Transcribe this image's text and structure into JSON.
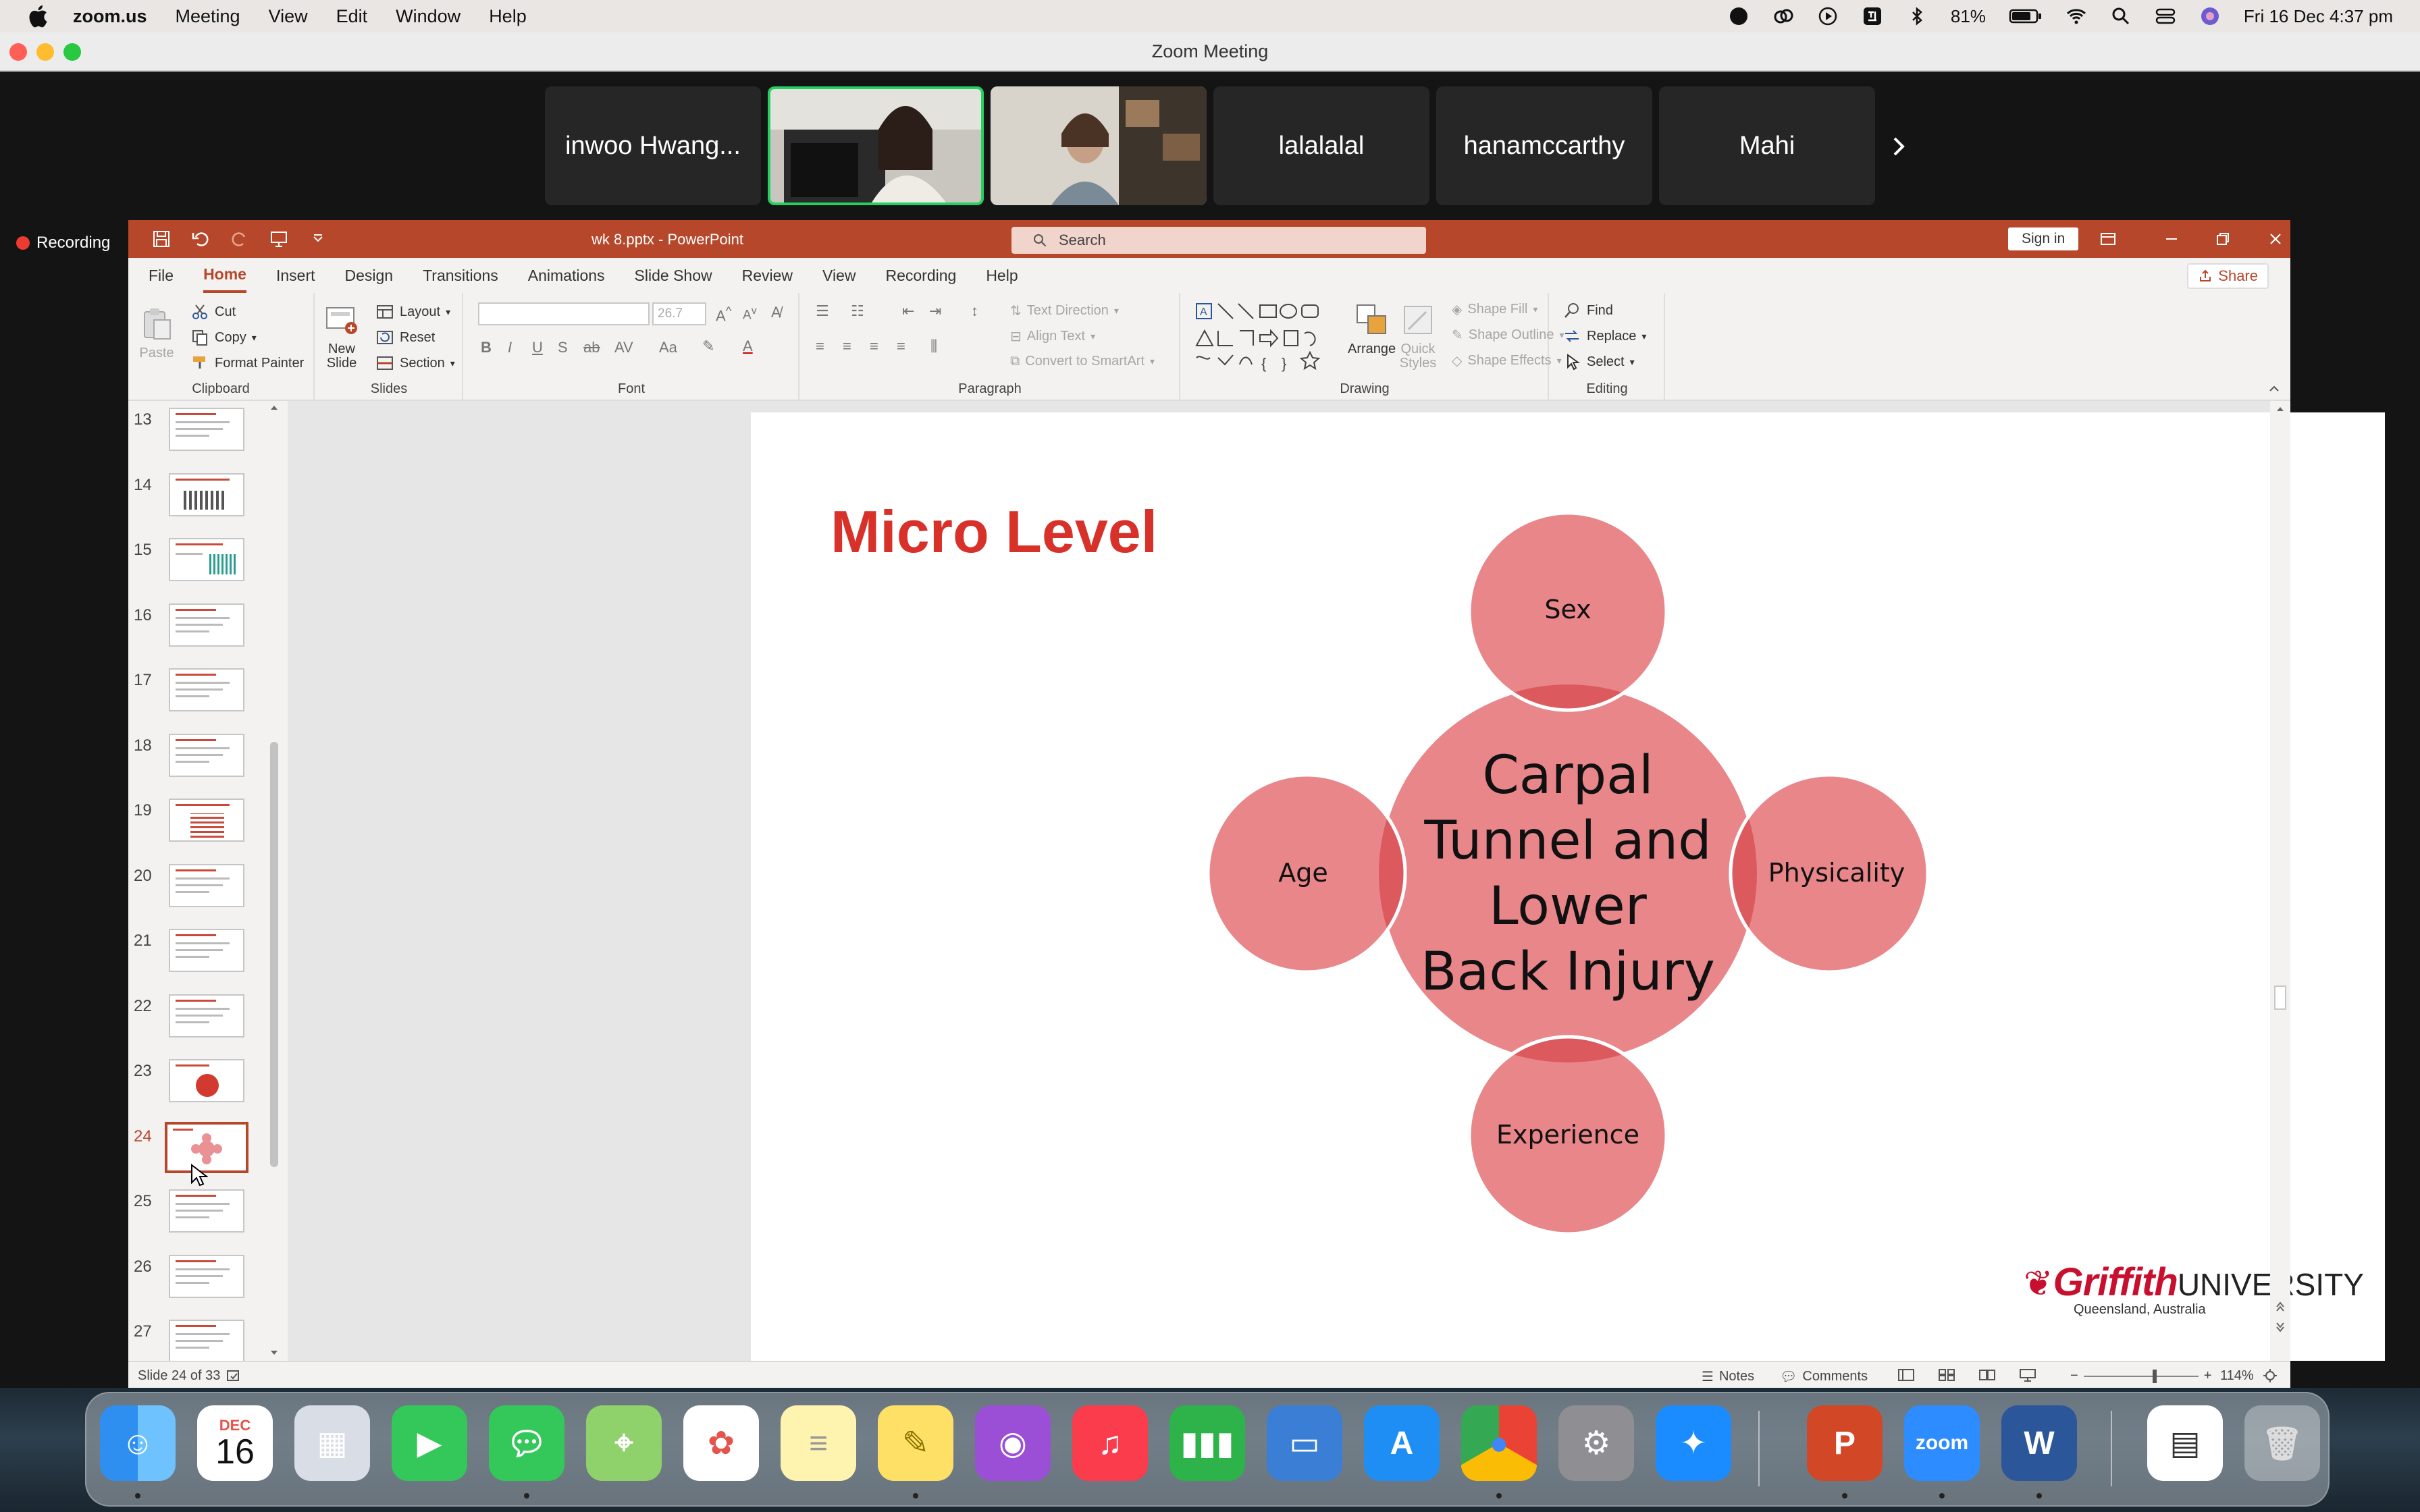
{
  "menubar": {
    "app_name": "zoom.us",
    "items": [
      "Meeting",
      "View",
      "Edit",
      "Window",
      "Help"
    ],
    "battery": "81%",
    "datetime": "Fri 16 Dec  4:37 pm"
  },
  "zoom": {
    "window_title": "Zoom Meeting",
    "recording_label": "Recording",
    "participants": [
      {
        "name": "inwoo Hwang...",
        "video": false
      },
      {
        "name": "",
        "video": true,
        "active": true
      },
      {
        "name": "",
        "video": true
      },
      {
        "name": "lalalalal",
        "video": false
      },
      {
        "name": "hanamccarthy",
        "video": false
      },
      {
        "name": "Mahi",
        "video": false
      }
    ]
  },
  "powerpoint": {
    "doc_title": "wk 8.pptx  -  PowerPoint",
    "search_placeholder": "Search",
    "signin_label": "Sign in",
    "share_label": "Share",
    "tabs": [
      "File",
      "Home",
      "Insert",
      "Design",
      "Transitions",
      "Animations",
      "Slide Show",
      "Review",
      "View",
      "Recording",
      "Help"
    ],
    "selected_tab": "Home",
    "ribbon": {
      "clipboard": {
        "label": "Clipboard",
        "paste": "Paste",
        "cut": "Cut",
        "copy": "Copy",
        "format_painter": "Format Painter"
      },
      "slides": {
        "label": "Slides",
        "new_slide": "New",
        "new_slide2": "Slide",
        "layout": "Layout",
        "reset": "Reset",
        "section": "Section"
      },
      "font": {
        "label": "Font",
        "size": "26.7"
      },
      "paragraph": {
        "label": "Paragraph",
        "text_direction": "Text Direction",
        "align_text": "Align Text",
        "convert_smartart": "Convert to SmartArt"
      },
      "drawing": {
        "label": "Drawing",
        "arrange": "Arrange",
        "quick_styles": "Quick",
        "quick_styles2": "Styles",
        "shape_fill": "Shape Fill",
        "shape_outline": "Shape Outline",
        "shape_effects": "Shape Effects"
      },
      "editing": {
        "label": "Editing",
        "find": "Find",
        "replace": "Replace",
        "select": "Select"
      }
    },
    "thumbnails": [
      "13",
      "14",
      "15",
      "16",
      "17",
      "18",
      "19",
      "20",
      "21",
      "22",
      "23",
      "24",
      "25",
      "26",
      "27"
    ],
    "current_slide": "24",
    "status": {
      "slide_info": "Slide 24 of 33",
      "notes": "Notes",
      "comments": "Comments",
      "zoom": "114%"
    }
  },
  "slide": {
    "title": "Micro Level",
    "center": [
      "Carpal",
      "Tunnel and",
      "Lower",
      "Back Injury"
    ],
    "top": "Sex",
    "left": "Age",
    "right": "Physicality",
    "bottom": "Experience",
    "circle_color": "#e8868a",
    "overlap_color": "#dc5a5e",
    "logo_brand": "Griffith",
    "logo_word": "UNIVERSITY",
    "logo_sub": "Queensland, Australia"
  },
  "dock": {
    "calendar_month": "DEC",
    "calendar_day": "16",
    "zoom_label": "zoom"
  },
  "colors": {
    "ppt_accent": "#b7472a",
    "zoom_active_border": "#23d160",
    "recording_dot": "#ee3b32",
    "title_red": "#d7312a"
  }
}
